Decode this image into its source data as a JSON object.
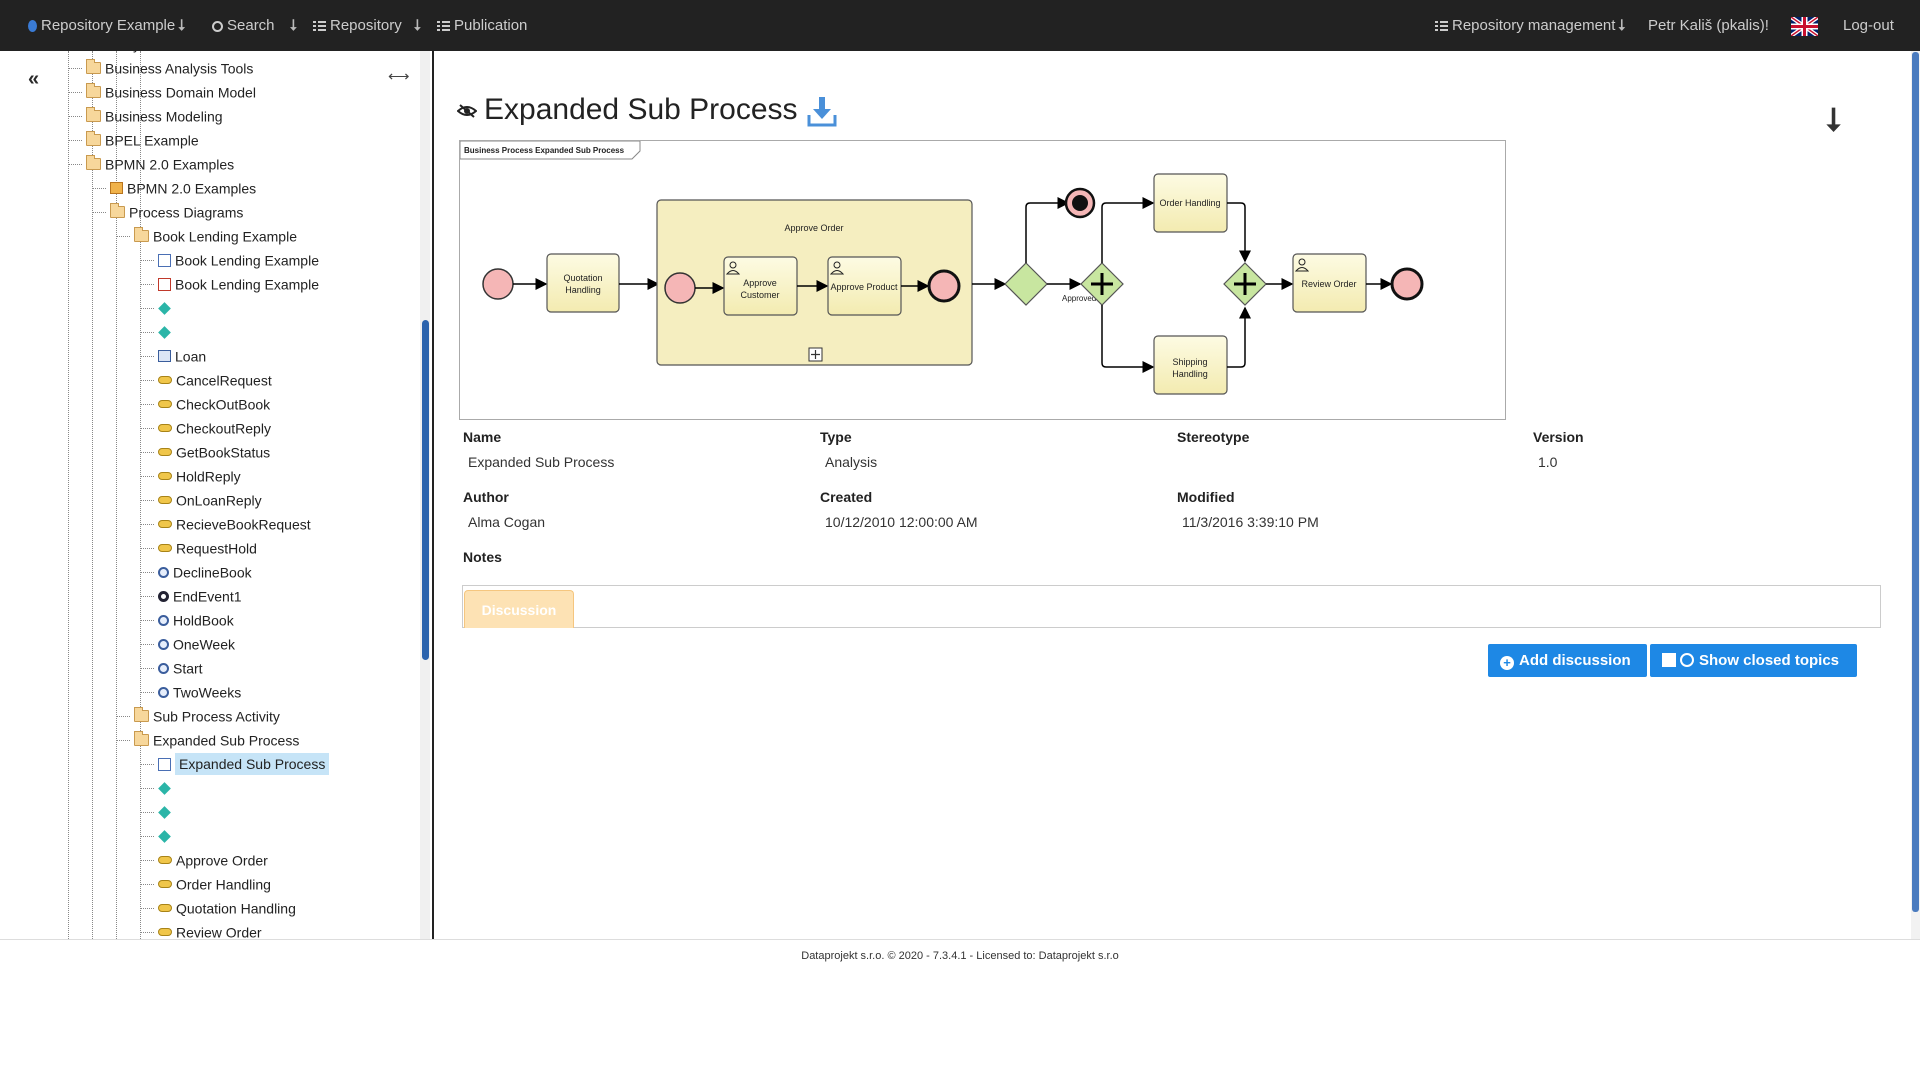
{
  "navbar": {
    "brand": "Repository Example",
    "search": "Search",
    "repository": "Repository",
    "publication": "Publication",
    "repo_mgmt": "Repository management",
    "user": "Petr Kališ (pkalis)!",
    "logout": "Log-out",
    "caret": "⭣"
  },
  "sidebar": {
    "collapse": "«",
    "expand": "⟷",
    "tree": [
      {
        "label": "Analysis",
        "icon": "folder"
      },
      {
        "label": "Business Analysis Tools",
        "icon": "folder"
      },
      {
        "label": "Business Domain Model",
        "icon": "folder"
      },
      {
        "label": "Business Modeling",
        "icon": "folder"
      },
      {
        "label": "BPEL Example",
        "icon": "folder"
      },
      {
        "label": "BPMN 2.0 Examples",
        "icon": "folder"
      },
      {
        "label": "BPMN 2.0 Examples",
        "icon": "package"
      },
      {
        "label": "Process Diagrams",
        "icon": "folder"
      },
      {
        "label": "Book Lending Example",
        "icon": "folder"
      },
      {
        "label": "Book Lending Example",
        "icon": "diagram"
      },
      {
        "label": "Book Lending Example",
        "icon": "diagram-red"
      },
      {
        "label": "",
        "icon": "diamond"
      },
      {
        "label": "",
        "icon": "diamond"
      },
      {
        "label": "Loan",
        "icon": "table"
      },
      {
        "label": "CancelRequest",
        "icon": "message"
      },
      {
        "label": "CheckOutBook",
        "icon": "message"
      },
      {
        "label": "CheckoutReply",
        "icon": "message"
      },
      {
        "label": "GetBookStatus",
        "icon": "message"
      },
      {
        "label": "HoldReply",
        "icon": "message"
      },
      {
        "label": "OnLoanReply",
        "icon": "message"
      },
      {
        "label": "RecieveBookRequest",
        "icon": "message"
      },
      {
        "label": "RequestHold",
        "icon": "message"
      },
      {
        "label": "DeclineBook",
        "icon": "event"
      },
      {
        "label": "EndEvent1",
        "icon": "end-event"
      },
      {
        "label": "HoldBook",
        "icon": "event"
      },
      {
        "label": "OneWeek",
        "icon": "event"
      },
      {
        "label": "Start",
        "icon": "event"
      },
      {
        "label": "TwoWeeks",
        "icon": "event"
      },
      {
        "label": "Sub Process Activity",
        "icon": "folder"
      },
      {
        "label": "Expanded Sub Process",
        "icon": "folder"
      },
      {
        "label": "Expanded Sub Process",
        "icon": "diagram"
      },
      {
        "label": "",
        "icon": "diamond"
      },
      {
        "label": "",
        "icon": "diamond"
      },
      {
        "label": "",
        "icon": "diamond"
      },
      {
        "label": "Approve Order",
        "icon": "message"
      },
      {
        "label": "Order Handling",
        "icon": "message"
      },
      {
        "label": "Quotation Handling",
        "icon": "message"
      },
      {
        "label": "Review Order",
        "icon": "message"
      }
    ]
  },
  "page": {
    "title": "Expanded Sub Process",
    "corner_icon": "⭣"
  },
  "diagram": {
    "frame_label": "Business Process Expanded Sub Process",
    "subprocess_title": "Approve Order",
    "tasks": {
      "quotation": [
        "Quotation",
        "Handling"
      ],
      "approve_customer": [
        "Approve",
        "Customer"
      ],
      "approve_product": "Approve Product",
      "order_handling": "Order Handling",
      "shipping": [
        "Shipping",
        "Handling"
      ],
      "review": "Review Order"
    },
    "approved_label": "Approved"
  },
  "properties": {
    "name_label": "Name",
    "name_value": "Expanded Sub Process",
    "type_label": "Type",
    "type_value": "Analysis",
    "stereotype_label": "Stereotype",
    "stereotype_value": "",
    "version_label": "Version",
    "version_value": "1.0",
    "author_label": "Author",
    "author_value": "Alma Cogan",
    "created_label": "Created",
    "created_value": "10/12/2010 12:00:00 AM",
    "modified_label": "Modified",
    "modified_value": "11/3/2016 3:39:10 PM",
    "notes_label": "Notes"
  },
  "discussion": {
    "tab": "Discussion",
    "add_button": "Add discussion",
    "show_closed_button": "Show closed topics"
  },
  "footer": "Dataprojekt s.r.o. © 2020 - 7.3.4.1 - Licensed to: Dataprojekt s.r.o"
}
